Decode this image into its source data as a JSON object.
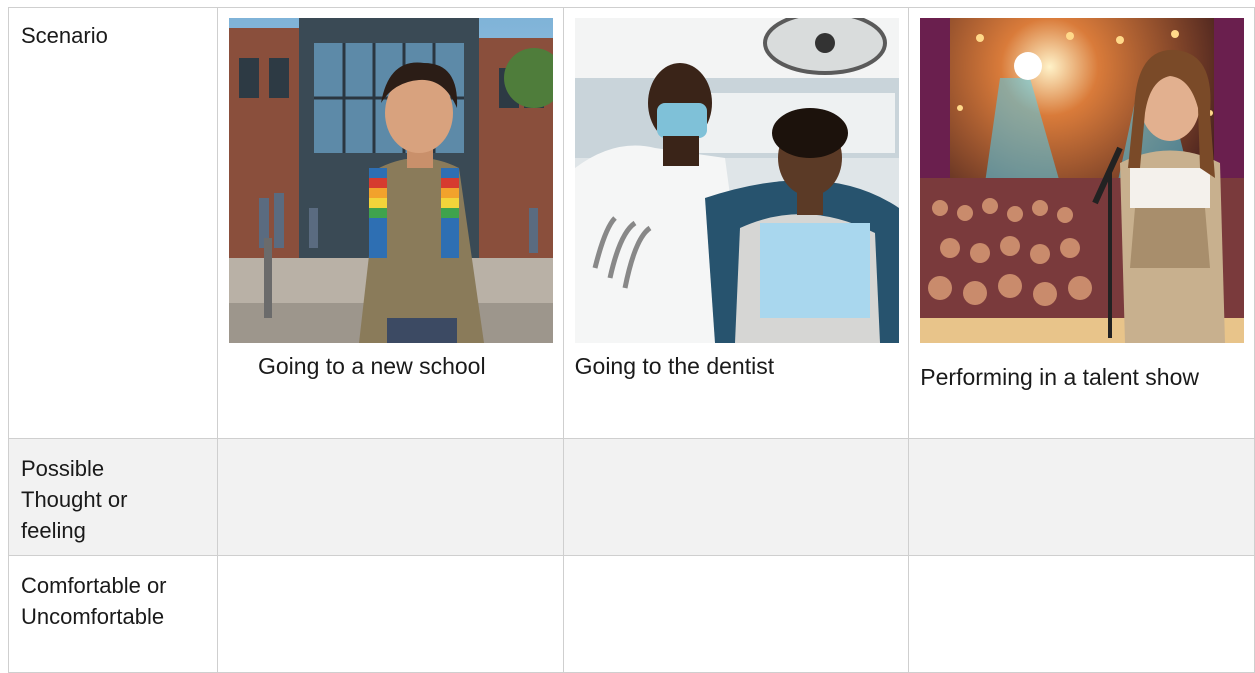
{
  "rows": {
    "scenario_label": "Scenario",
    "thought_label": "Possible Thought or feeling",
    "comfort_label": "Comfortable or Uncomfortable"
  },
  "scenarios": [
    {
      "caption": "Going to a new school",
      "image": "boy-with-backpack-outside-school-photo"
    },
    {
      "caption": "Going to the dentist",
      "image": "boy-in-dentist-chair-photo"
    },
    {
      "caption": "Performing in a talent show",
      "image": "girl-at-microphone-on-stage-photo"
    }
  ]
}
